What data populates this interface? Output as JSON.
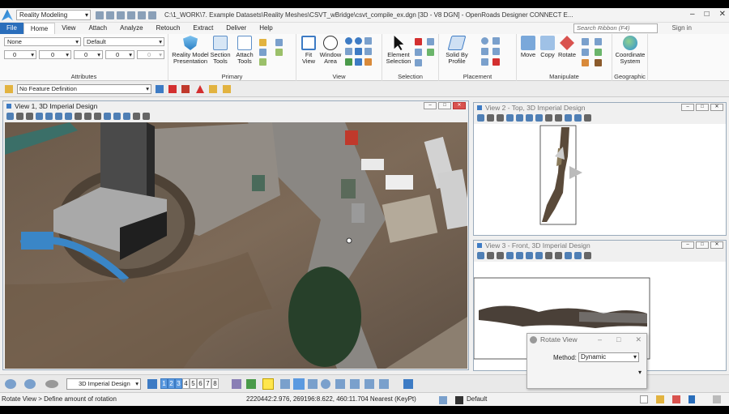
{
  "titlebar": {
    "workspace": "Reality Modeling",
    "document_title": "C:\\1_WORK\\7. Example Datasets\\Reality Meshes\\CSVT_wBridge\\csvt_compile_ex.dgn [3D - V8 DGN] - OpenRoads Designer CONNECT E..."
  },
  "tabs": [
    "File",
    "Home",
    "View",
    "Attach",
    "Analyze",
    "Retouch",
    "Extract",
    "Deliver",
    "Help"
  ],
  "search_placeholder": "Search Ribbon (F4)",
  "sign_in": "Sign in",
  "ribbon": {
    "attributes": {
      "label": "Attributes",
      "level": "None",
      "style": "Default",
      "color": "0",
      "weight": "0",
      "linestyle": "0",
      "transparency": "0",
      "priority": "0"
    },
    "primary": {
      "label": "Primary",
      "buttons": [
        "Reality Model Presentation",
        "Section Tools",
        "Attach Tools"
      ]
    },
    "view": {
      "label": "View",
      "buttons": [
        "Fit View",
        "Window Area"
      ]
    },
    "selection": {
      "label": "Selection",
      "buttons": [
        "Element Selection"
      ]
    },
    "placement": {
      "label": "Placement",
      "buttons": [
        "Solid By Profile"
      ]
    },
    "manipulate": {
      "label": "Manipulate",
      "buttons": [
        "Move",
        "Copy",
        "Rotate"
      ]
    },
    "geographic": {
      "label": "Geographic",
      "buttons": [
        "Coordinate System"
      ]
    }
  },
  "feature_definition": "No Feature Definition",
  "views": {
    "v1": "View 1, 3D Imperial Design",
    "v2": "View 2 - Top, 3D Imperial Design",
    "v3": "View 3 - Front, 3D Imperial Design"
  },
  "bottombar": {
    "view_group": "3D Imperial Design",
    "view_numbers": [
      "1",
      "2",
      "3",
      "4",
      "5",
      "6",
      "7",
      "8"
    ]
  },
  "statusbar": {
    "prompt": "Rotate View > Define amount of rotation",
    "coordinates": "2220442:2.976, 269196:8.622, 460:11.704 Nearest (KeyPt)",
    "level": "Default"
  },
  "dialog": {
    "title": "Rotate View",
    "method_label": "Method:",
    "method_value": "Dynamic"
  },
  "colors": {
    "accent": "#2a6ebb",
    "view_border": "#99aabb"
  }
}
